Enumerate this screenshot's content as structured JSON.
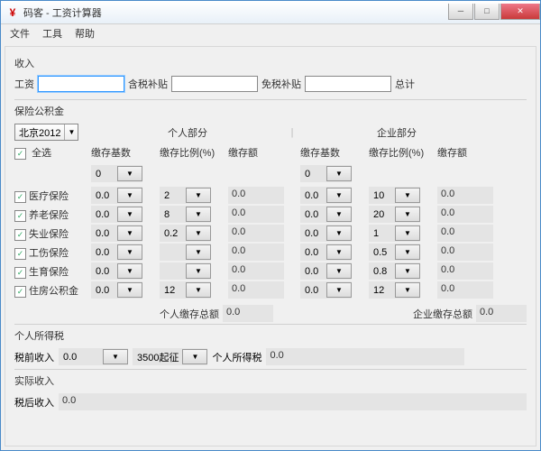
{
  "window": {
    "title": "码客 - 工资计算器",
    "icon_text": "¥"
  },
  "winbtns": {
    "min": "─",
    "max": "□",
    "close": "✕"
  },
  "menu": {
    "file": "文件",
    "tool": "工具",
    "help": "帮助"
  },
  "income": {
    "section": "收入",
    "salary_label": "工资",
    "taxable_label": "含税补贴",
    "exempt_label": "免税补贴",
    "total_label": "总计"
  },
  "insurance": {
    "section": "保险公积金",
    "region": "北京2012",
    "personal_part": "个人部分",
    "company_part": "企业部分",
    "select_all": "全选",
    "hdr_base": "缴存基数",
    "hdr_rate": "缴存比例(%)",
    "hdr_amount": "缴存额",
    "header_base_value": "0",
    "rows": [
      {
        "name": "医疗保险",
        "p_base": "0.0",
        "p_rate": "2",
        "p_amt": "0.0",
        "c_base": "0.0",
        "c_rate": "10",
        "c_amt": "0.0"
      },
      {
        "name": "养老保险",
        "p_base": "0.0",
        "p_rate": "8",
        "p_amt": "0.0",
        "c_base": "0.0",
        "c_rate": "20",
        "c_amt": "0.0"
      },
      {
        "name": "失业保险",
        "p_base": "0.0",
        "p_rate": "0.2",
        "p_amt": "0.0",
        "c_base": "0.0",
        "c_rate": "1",
        "c_amt": "0.0"
      },
      {
        "name": "工伤保险",
        "p_base": "0.0",
        "p_rate": "",
        "p_amt": "0.0",
        "c_base": "0.0",
        "c_rate": "0.5",
        "c_amt": "0.0"
      },
      {
        "name": "生育保险",
        "p_base": "0.0",
        "p_rate": "",
        "p_amt": "0.0",
        "c_base": "0.0",
        "c_rate": "0.8",
        "c_amt": "0.0"
      },
      {
        "name": "住房公积金",
        "p_base": "0.0",
        "p_rate": "12",
        "p_amt": "0.0",
        "c_base": "0.0",
        "c_rate": "12",
        "c_amt": "0.0"
      }
    ],
    "personal_total_label": "个人缴存总额",
    "personal_total": "0.0",
    "company_total_label": "企业缴存总额",
    "company_total": "0.0"
  },
  "tax": {
    "section": "个人所得税",
    "pretax_label": "税前收入",
    "pretax_value": "0.0",
    "threshold": "3500起征",
    "tax_label": "个人所得税",
    "tax_value": "0.0"
  },
  "net": {
    "section": "实际收入",
    "net_label": "税后收入",
    "net_value": "0.0"
  },
  "glyphs": {
    "check": "✓",
    "down": "▼"
  }
}
